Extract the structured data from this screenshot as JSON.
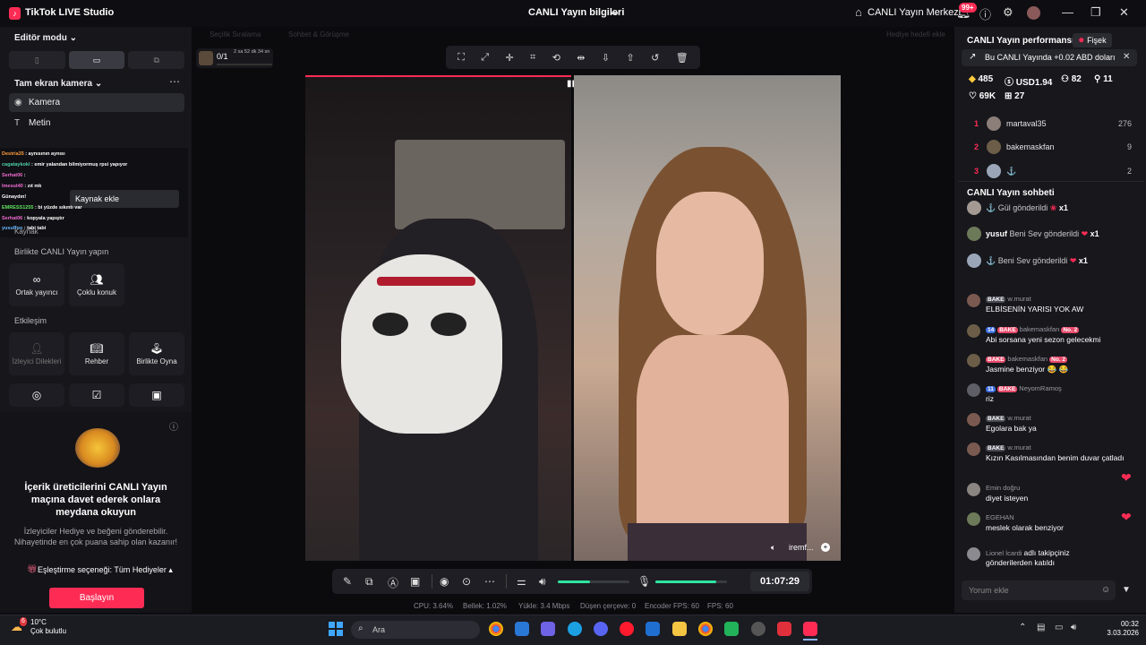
{
  "titlebar": {
    "app_name": "TikTok LIVE Studio",
    "center_title": "CANLI Yayın bilgileri",
    "center_link": "CANLI Yayın Merkezi",
    "notif_badge": "99+"
  },
  "left_panel": {
    "editor_mode": "Editör modu",
    "scene": "Tam ekran kamera",
    "sources": [
      "Kamera",
      "Metin"
    ],
    "add_source": "Kaynak ekle",
    "mini_chat": [
      {
        "user": "Destria35",
        "text": "aynısının aynısı"
      },
      {
        "user": "cagataykokl",
        "text": "emir yalandan bilmiyormuş rpsi yapıyor"
      },
      {
        "user": "Serhat06",
        "text": ""
      },
      {
        "user": "lmesut40",
        "text": "zıt mk"
      },
      {
        "user": "",
        "text": "Günaydın!"
      },
      {
        "user": "EMRESS1255",
        "text": "bi yüzde sıkıntı var"
      },
      {
        "user": "Serhat06",
        "text": "kopyala yapıştır"
      },
      {
        "user": "yusuffoo",
        "text": "tabi tabi"
      }
    ],
    "faded_label": "Kaynak",
    "collab_heading": "Birlikte CANLI Yayın yapın",
    "collab": [
      "Ortak yayıncı",
      "Çoklu konuk"
    ],
    "interaction_heading": "Etkileşim",
    "interaction": [
      "İzleyici Dilekleri",
      "Rehber",
      "Birlikte Oyna"
    ]
  },
  "promo": {
    "title": "İçerik üreticilerini CANLI Yayın maçına davet ederek onlara meydana okuyun",
    "description": "İzleyiciler Hediye ve beğeni gönderebilir. Nihayetinde en çok puana sahip olan kazanır!",
    "match_option": "Eşleştirme seçeneği: Tüm Hediyeler",
    "start_button": "Başlayın"
  },
  "center": {
    "top_left_counter": "0/1",
    "top_left_time": "2 sa 52 dk 34 sn",
    "tabs_faded": [
      "Seçilik Sıralama",
      "Sohbet & Görüşme"
    ],
    "gift_goal_hint": "Hediye hedefi ekle",
    "guest_label": "iremf...",
    "timer": "01:07:29",
    "volume_level": 0.45,
    "mic_level": 0.85,
    "stats": {
      "cpu": "CPU: 3.64%",
      "memory": "Bellek: 1.02%",
      "upload": "Yükle: 3.4 Mbps",
      "dropped": "Düşen çerçeve: 0",
      "encoder_fps": "Encoder FPS: 60",
      "fps": "FPS: 60"
    }
  },
  "right_panel": {
    "performance_title": "CANLI Yayın performansı",
    "fisek": "Fişek",
    "banner": "Bu CANLI Yayında +0.02 ABD doları",
    "stats": {
      "diamonds": "485",
      "usd": "USD1.94",
      "viewers": "82",
      "new_followers": "11",
      "likes": "69K",
      "gifters": "27"
    },
    "ranking": [
      {
        "rank": "1",
        "name": "martaval35",
        "score": "276"
      },
      {
        "rank": "2",
        "name": "bakemaskfan",
        "score": "9"
      },
      {
        "rank": "3",
        "name": "",
        "score": "2"
      }
    ],
    "chat_title": "CANLI Yayın sohbeti",
    "gifts": [
      {
        "user": "",
        "text": "Gül gönderildi",
        "count": "x1"
      },
      {
        "user": "yusuf",
        "text": "Beni Sev gönderildi",
        "count": "x1"
      },
      {
        "user": "",
        "text": "Beni Sev gönderildi",
        "count": "x1"
      }
    ],
    "messages": [
      {
        "badges": [
          "BAKE"
        ],
        "user": "w.murat",
        "text": "ELBİSENİN YARISI YOK AW"
      },
      {
        "badges": [
          "14",
          "BAKE"
        ],
        "user": "bakemaskfan",
        "rank_badge": "No. 2",
        "text": "Abi sorsana yeni sezon gelecekmi"
      },
      {
        "badges": [
          "BAKE"
        ],
        "user": "bakemaskfan",
        "rank_badge": "No. 2",
        "text": "Jasmine benziyor 😂 😂"
      },
      {
        "badges": [
          "11",
          "BAKE"
        ],
        "user": "NeyomRamoş",
        "text": "riz"
      },
      {
        "badges": [
          "BAKE"
        ],
        "user": "w.murat",
        "text": "Egolara bak ya"
      },
      {
        "badges": [
          "BAKE"
        ],
        "user": "w.murat",
        "text": "Kızın Kasılmasından benim duvar çatladı"
      },
      {
        "badges": [],
        "user": "Emin doğru",
        "text": "diyet isteyen"
      },
      {
        "badges": [],
        "user": "EGEHAN",
        "text": "meslek olarak benziyor"
      },
      {
        "badges": [],
        "user": "Lionel İcardi",
        "inline": "adlı takipçiniz",
        "text": "gönderilerden katıldı"
      }
    ],
    "comment_placeholder": "Yorum ekle"
  },
  "taskbar": {
    "weather_temp": "10°C",
    "weather_desc": "Çok bulutlu",
    "weather_badge": "6",
    "search": "Ara",
    "time": "00:32",
    "date": "3.03.2026"
  }
}
